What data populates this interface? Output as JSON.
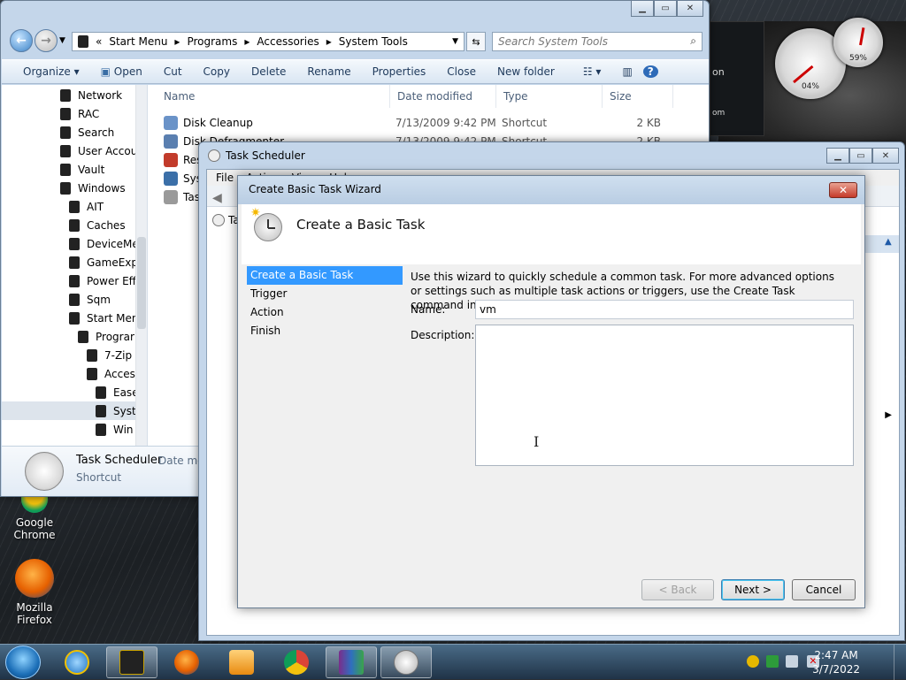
{
  "explorer": {
    "address_crumbs": [
      "«",
      "Start Menu",
      "▸",
      "Programs",
      "▸",
      "Accessories",
      "▸",
      "System Tools"
    ],
    "search_placeholder": "Search System Tools",
    "commands": [
      "Organize ▾",
      "Open",
      "Cut",
      "Copy",
      "Delete",
      "Rename",
      "Properties",
      "Close",
      "New folder"
    ],
    "tree": [
      {
        "label": "Network",
        "indent": 0
      },
      {
        "label": "RAC",
        "indent": 0
      },
      {
        "label": "Search",
        "indent": 0
      },
      {
        "label": "User Accou",
        "indent": 0
      },
      {
        "label": "Vault",
        "indent": 0
      },
      {
        "label": "Windows",
        "indent": 0
      },
      {
        "label": "AIT",
        "indent": 1
      },
      {
        "label": "Caches",
        "indent": 1
      },
      {
        "label": "DeviceMe",
        "indent": 1
      },
      {
        "label": "GameExp",
        "indent": 1
      },
      {
        "label": "Power Eff",
        "indent": 1
      },
      {
        "label": "Sqm",
        "indent": 1
      },
      {
        "label": "Start Men",
        "indent": 1
      },
      {
        "label": "Prograr",
        "indent": 2
      },
      {
        "label": "7-Zip",
        "indent": 3
      },
      {
        "label": "Acces",
        "indent": 3
      },
      {
        "label": "Ease",
        "indent": 4
      },
      {
        "label": "Syst",
        "indent": 4
      },
      {
        "label": "Win",
        "indent": 4
      }
    ],
    "columns": [
      "Name",
      "Date modified",
      "Type",
      "Size"
    ],
    "files": [
      {
        "name": "Disk Cleanup",
        "date": "7/13/2009 9:42 PM",
        "type": "Shortcut",
        "size": "2 KB"
      },
      {
        "name": "Disk Defragmenter",
        "date": "7/13/2009 9:42 PM",
        "type": "Shortcut",
        "size": "2 KB"
      },
      {
        "name": "Res",
        "date": "",
        "type": "",
        "size": ""
      },
      {
        "name": "Sys",
        "date": "",
        "type": "",
        "size": ""
      },
      {
        "name": "Tas",
        "date": "",
        "type": "",
        "size": ""
      }
    ],
    "details": {
      "name": "Task Scheduler",
      "meta": "Date mo",
      "type": "Shortcut"
    }
  },
  "task_scheduler": {
    "title": "Task Scheduler",
    "menu": [
      "File",
      "Action",
      "View",
      "Help"
    ],
    "tree_item": "Ta"
  },
  "wizard": {
    "title": "Create Basic Task Wizard",
    "close_label": "✕",
    "header_title": "Create a Basic Task",
    "steps": [
      "Create a Basic Task",
      "Trigger",
      "Action",
      "Finish"
    ],
    "active_step": 0,
    "description": "Use this wizard to quickly schedule a common task.  For more advanced options or settings such as multiple task actions or triggers, use the Create Task command in the Actions pane.",
    "name_label": "Name:",
    "name_value": "vm",
    "description_label": "Description:",
    "description_value": "",
    "back_label": "< Back",
    "next_label": "Next >",
    "cancel_label": "Cancel"
  },
  "desktop": {
    "icons": [
      {
        "label": "Google Chrome"
      },
      {
        "label": "Mozilla Firefox"
      }
    ],
    "gadget_text_1": "on",
    "gadget_text_2": "om",
    "cpu_gauge": "04%",
    "mem_gauge": "59%",
    "cpu_level": 0.04,
    "mem_level": 0.59
  },
  "taskbar": {
    "time": "2:47 AM",
    "date": "3/7/2022"
  },
  "colors": {
    "selection": "#3399ff",
    "titlebar": "#c4d6ea"
  }
}
